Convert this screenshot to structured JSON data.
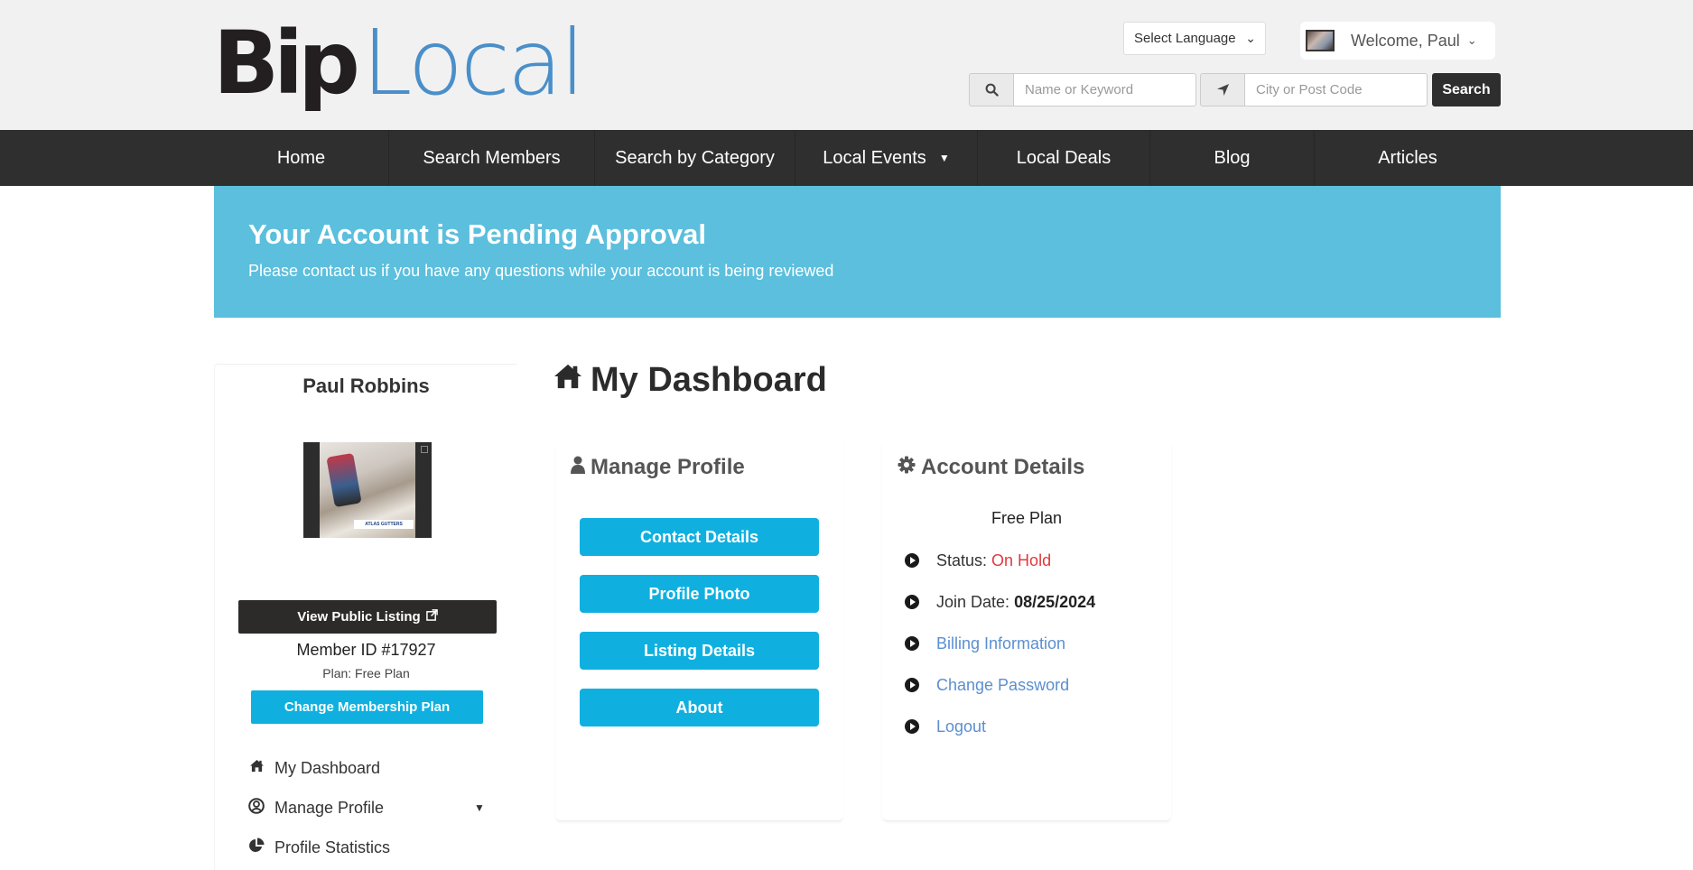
{
  "header": {
    "logo": {
      "part1": "Bip",
      "part2": "Local"
    },
    "language_select": {
      "selected": "Select Language"
    },
    "user_menu": {
      "label": "Welcome, Paul"
    },
    "search": {
      "keyword_placeholder": "Name or Keyword",
      "location_placeholder": "City or Post Code",
      "button_label": "Search"
    }
  },
  "nav": {
    "items": [
      {
        "label": "Home"
      },
      {
        "label": "Search Members"
      },
      {
        "label": "Search by Category"
      },
      {
        "label": "Local Events",
        "has_dropdown": true
      },
      {
        "label": "Local Deals"
      },
      {
        "label": "Blog"
      },
      {
        "label": "Articles"
      }
    ]
  },
  "banner": {
    "title": "Your Account is Pending Approval",
    "message": "Please contact us if you have any questions while your account is being reviewed",
    "color": "#5bbfdd"
  },
  "sidebar": {
    "name": "Paul Robbins",
    "photo_caption": "ATLAS GUTTERS",
    "view_public_label": "View Public Listing",
    "member_id": "Member ID #17927",
    "plan": "Plan: Free Plan",
    "change_plan_label": "Change Membership Plan",
    "menu": [
      {
        "label": "My Dashboard",
        "icon": "home-icon"
      },
      {
        "label": "Manage Profile",
        "icon": "user-circle-icon",
        "has_dropdown": true
      },
      {
        "label": "Profile Statistics",
        "icon": "pie-chart-icon"
      }
    ]
  },
  "main": {
    "title": "My Dashboard",
    "manage_profile": {
      "title": "Manage Profile",
      "buttons": [
        {
          "label": "Contact Details"
        },
        {
          "label": "Profile Photo"
        },
        {
          "label": "Listing Details"
        },
        {
          "label": "About"
        }
      ]
    },
    "account_details": {
      "title": "Account Details",
      "plan": "Free Plan",
      "status_label": "Status:",
      "status_value": "On Hold",
      "status_color": "#e0393e",
      "join_label": "Join Date:",
      "join_value": "08/25/2024",
      "links": [
        {
          "label": "Billing Information"
        },
        {
          "label": "Change Password"
        },
        {
          "label": "Logout"
        }
      ]
    }
  },
  "colors": {
    "accent": "#0fb0e0",
    "nav_bg": "#2f2f2f",
    "link": "#5b8fd0"
  }
}
